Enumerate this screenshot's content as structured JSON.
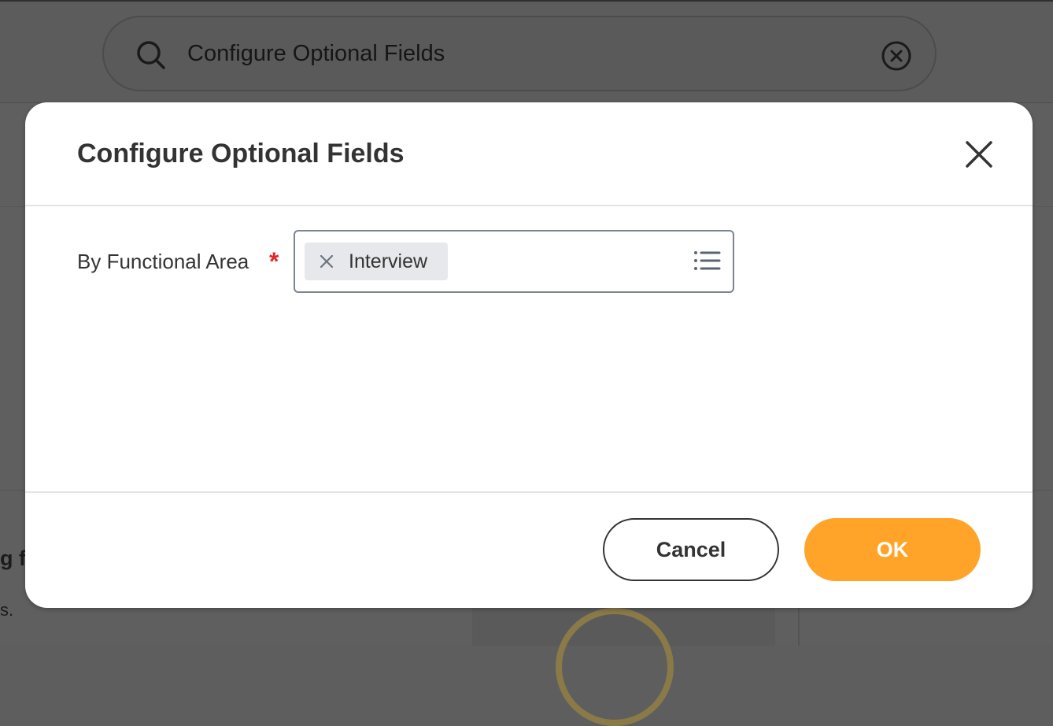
{
  "background": {
    "search": {
      "value": "Configure Optional Fields"
    },
    "partial_heading": "g f",
    "partial_text": "s."
  },
  "dialog": {
    "title": "Configure Optional Fields",
    "field": {
      "label": "By Functional Area",
      "required_marker": "*",
      "selected_items": [
        "Interview"
      ]
    },
    "buttons": {
      "cancel": "Cancel",
      "ok": "OK"
    }
  },
  "colors": {
    "primary_button": "#ffa428",
    "required": "#de2a2a",
    "text": "#333333",
    "chip_bg": "#e6e8eb"
  },
  "icons": [
    "search-icon",
    "clear-icon",
    "close-icon",
    "remove-chip-icon",
    "list-icon"
  ]
}
